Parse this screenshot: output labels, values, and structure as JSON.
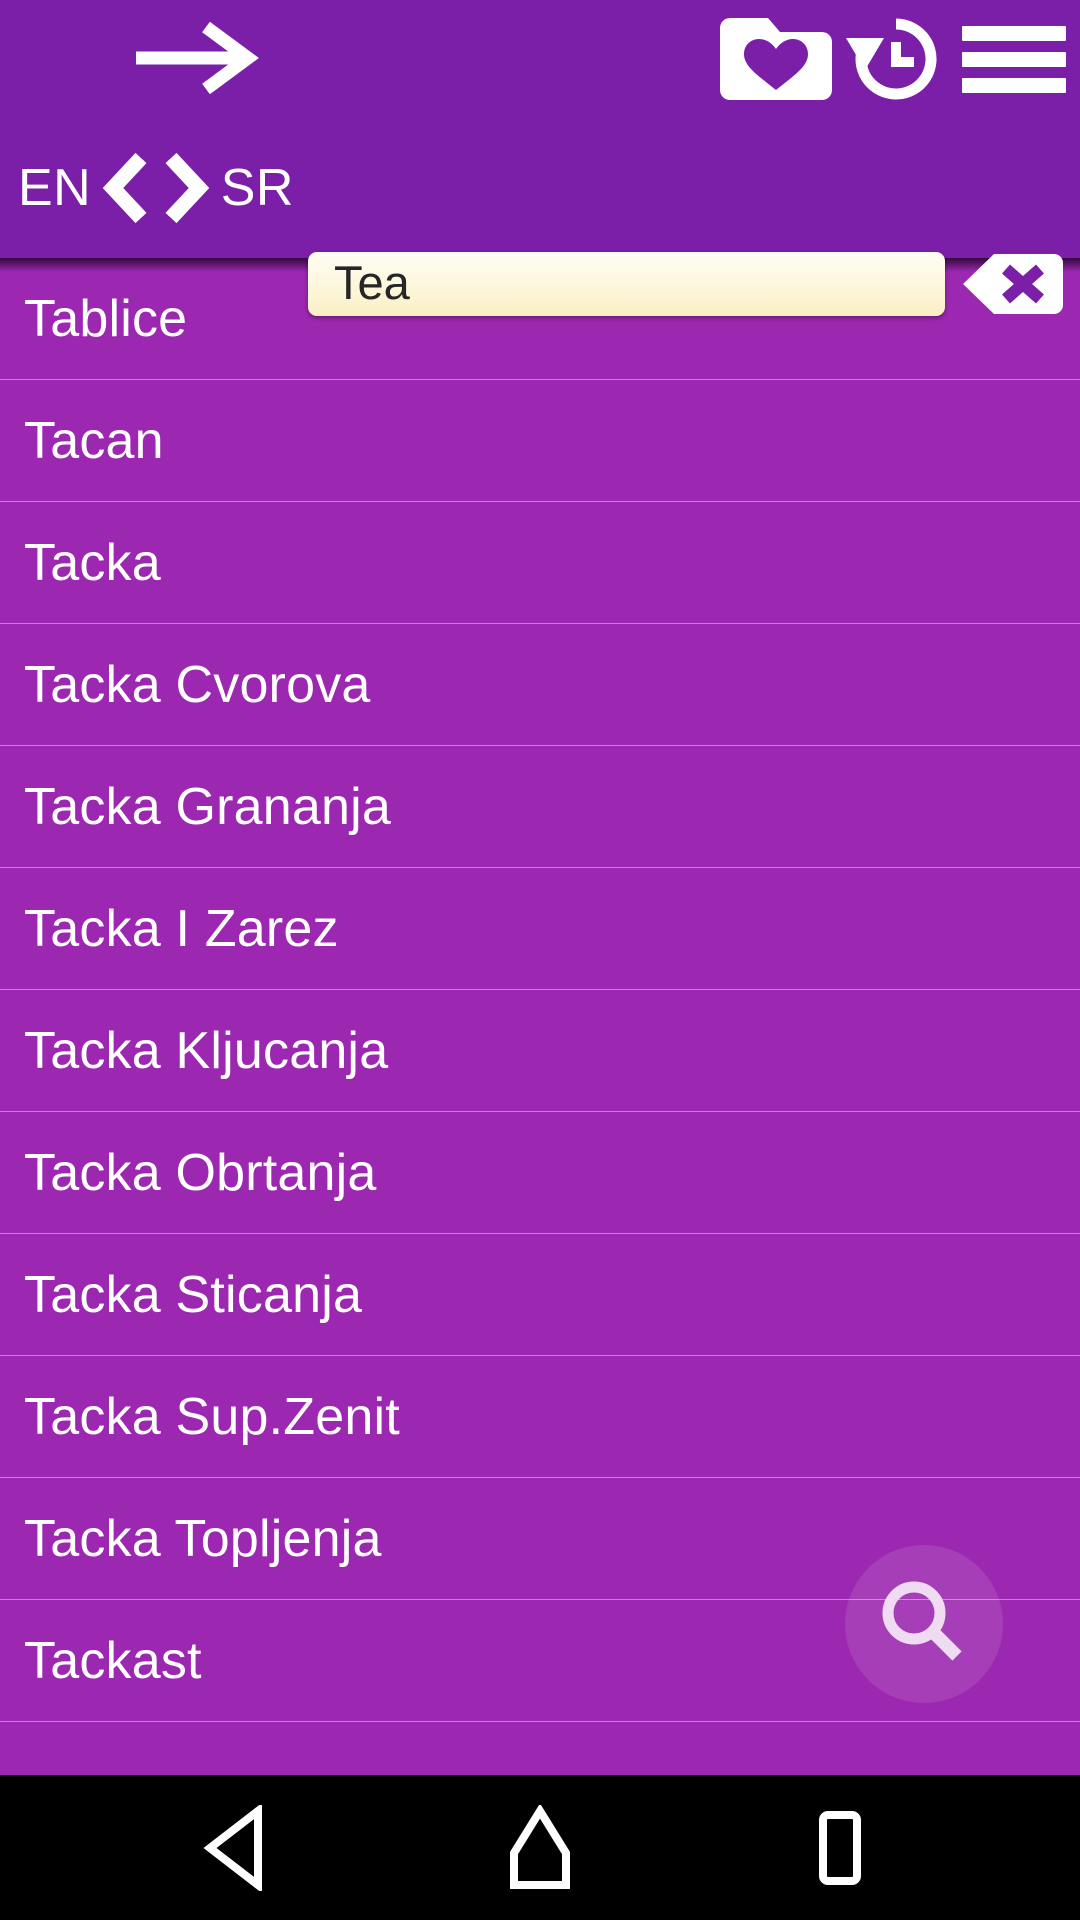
{
  "header": {
    "forward_arrow_icon": "arrow-right-icon",
    "favorites_icon": "folder-heart-icon",
    "history_icon": "history-clock-icon",
    "menu_icon": "hamburger-menu-icon",
    "background_color": "#7B1FA8"
  },
  "language_switcher": {
    "source_language": "EN",
    "target_language": "SR",
    "swap_left_icon": "chevron-left-icon",
    "swap_right_icon": "chevron-right-icon"
  },
  "search": {
    "value": "Tea",
    "placeholder": "",
    "clear_icon": "backspace-clear-icon",
    "field_color": "#FDF8E0"
  },
  "results": {
    "background_color": "#9C27B0",
    "items": [
      {
        "label": "Tablice"
      },
      {
        "label": "Tacan"
      },
      {
        "label": "Tacka"
      },
      {
        "label": "Tacka Cvorova"
      },
      {
        "label": "Tacka Grananja"
      },
      {
        "label": "Tacka I Zarez"
      },
      {
        "label": "Tacka Kljucanja"
      },
      {
        "label": "Tacka Obrtanja"
      },
      {
        "label": "Tacka Sticanja"
      },
      {
        "label": "Tacka Sup.Zenit"
      },
      {
        "label": "Tacka Topljenja"
      },
      {
        "label": "Tackast"
      },
      {
        "label": ""
      }
    ]
  },
  "fab": {
    "icon": "search-magnifier-icon"
  },
  "navbar": {
    "back_icon": "triangle-back-icon",
    "home_icon": "house-home-icon",
    "recents_icon": "square-recents-icon",
    "background_color": "#000000"
  }
}
